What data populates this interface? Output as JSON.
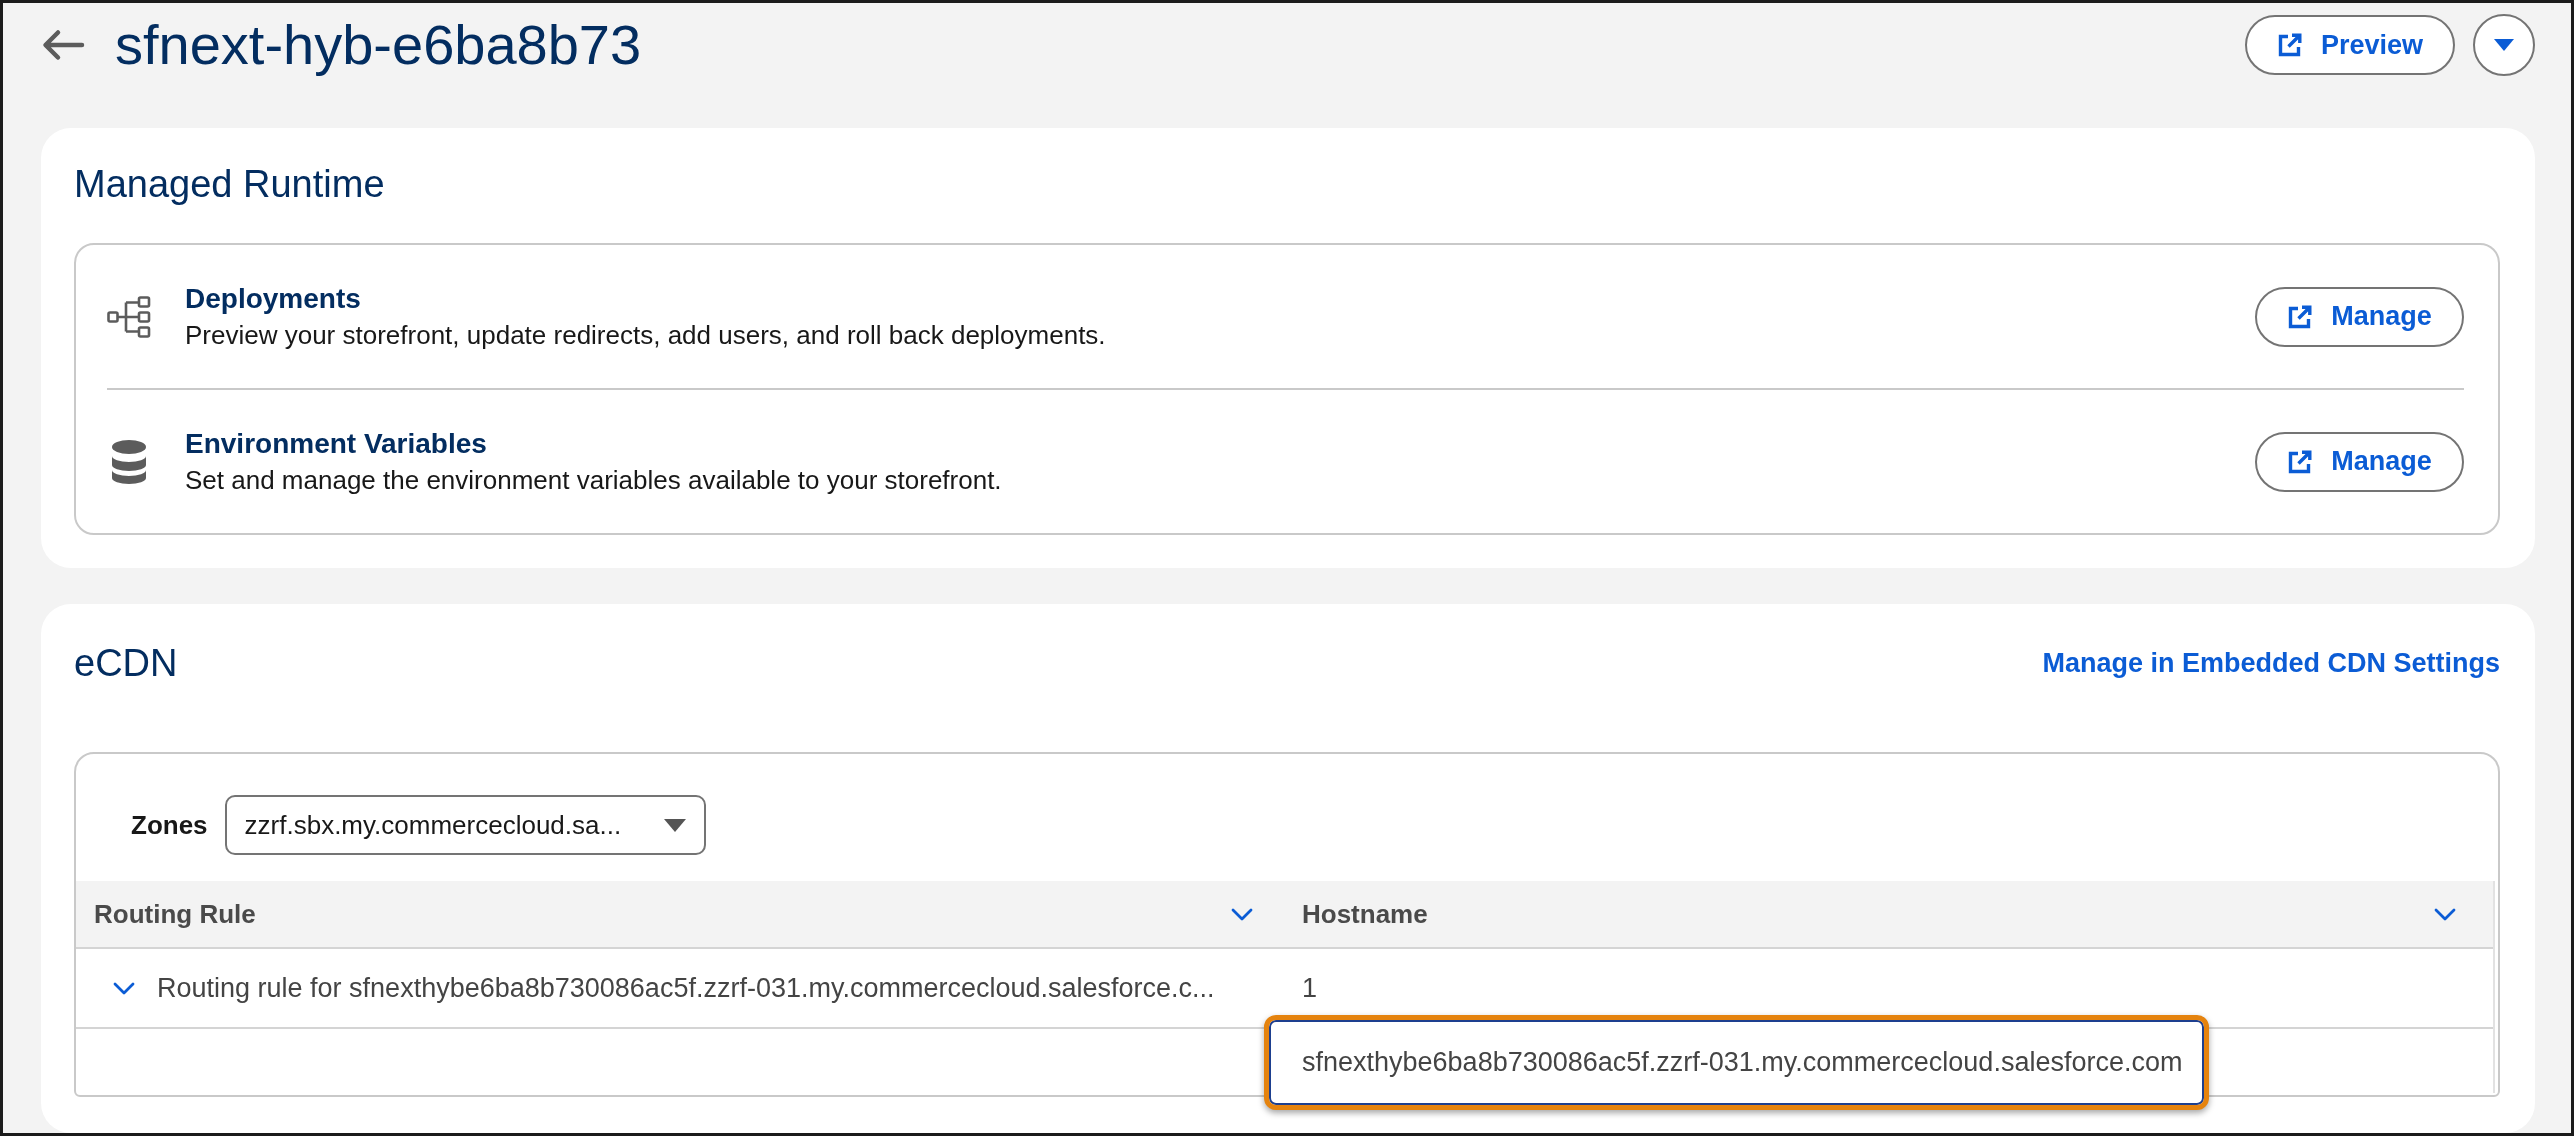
{
  "header": {
    "title": "sfnext-hyb-e6ba8b73",
    "preview_button": "Preview"
  },
  "managed_runtime": {
    "title": "Managed Runtime",
    "items": [
      {
        "title": "Deployments",
        "description": "Preview your storefront, update redirects, add users, and roll back deployments.",
        "button": "Manage"
      },
      {
        "title": "Environment Variables",
        "description": "Set and manage the environment variables available to your storefront.",
        "button": "Manage"
      }
    ]
  },
  "ecdn": {
    "title": "eCDN",
    "settings_link": "Manage in Embedded CDN Settings",
    "zones": {
      "label": "Zones",
      "value": "zzrf.sbx.my.commercecloud.sa..."
    },
    "table": {
      "columns": [
        "Routing Rule",
        "Hostname"
      ],
      "rows": [
        {
          "routing_rule": "Routing rule for sfnexthybe6ba8b730086ac5f.zzrf-031.my.commercecloud.salesforce.c...",
          "hostname": "1",
          "expanded": true,
          "children": [
            {
              "hostname": "sfnexthybe6ba8b730086ac5f.zzrf-031.my.commercecloud.salesforce.com",
              "highlighted": true
            }
          ]
        }
      ]
    }
  }
}
